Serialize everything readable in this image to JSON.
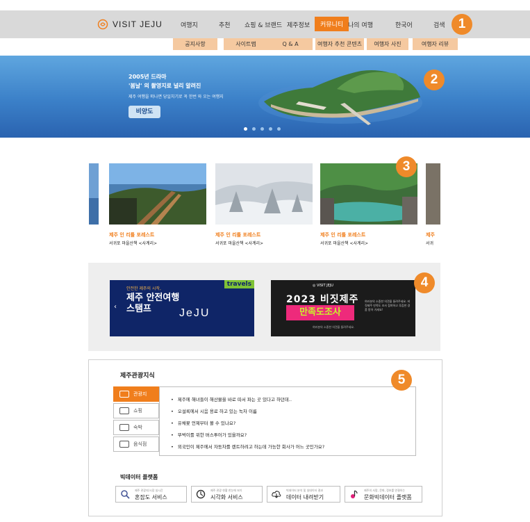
{
  "header": {
    "logo_text": "VISIT JEJU",
    "nav": [
      "여행지",
      "추천",
      "쇼핑 & 브랜드",
      "제주정보",
      "커뮤니티",
      "나의 여행",
      "한국어",
      "검색"
    ],
    "active_nav": "커뮤니티",
    "subnav": [
      "공지사항",
      "사이트맵",
      "Q & A",
      "여행자 추천 콘텐츠",
      "여행자 사진",
      "여행자 리뷰"
    ]
  },
  "badges": [
    "1",
    "2",
    "3",
    "4",
    "5"
  ],
  "hero": {
    "line1": "2005년 드라마",
    "line2": "'봄날' 의 촬영지로 널리 알려진",
    "line3": "제주 여행을 떠나면 당일치기로 꼭 한번 와 오는 여행지",
    "button": "비양도",
    "slide_count": 5,
    "active_slide": 1
  },
  "carousel": {
    "cards": [
      {
        "title": "제주 인 리틀 포레스트",
        "subtitle": "서귀포 마을산책 <사계리>"
      },
      {
        "title": "제주 인 리틀 포레스트",
        "subtitle": "서귀포 마을산책 <사계리>"
      },
      {
        "title": "제주 인 리틀 포레스트",
        "subtitle": "서귀포 마을산책 <사계리>"
      },
      {
        "title": "제주",
        "subtitle": "서귀"
      }
    ]
  },
  "banners": {
    "b1": {
      "small": "안전한 제주의 시작,",
      "big": "제주 안전여행 스탬프",
      "brand": "JeJU",
      "tag": "travels",
      "arrow": "‹"
    },
    "b2": {
      "logo": "◎ VISIT JEJU",
      "year": "2023 비짓제주",
      "title": "만족도조사",
      "info": "여러분의 소중한 의견을 들려주세요. 비짓제주 만족도 조사 참여하고 푸짐한 경품 받아 가세요!",
      "foot": "여러분의 소중한 의견을 들려주세요."
    }
  },
  "info": {
    "title": "제주관광지식",
    "tabs": [
      "관광지",
      "쇼핑",
      "숙박",
      "음식점"
    ],
    "faq": [
      "제주에 해녀들이 해산물을 바로 따서 파는 곳 있다고 하던데..",
      "오설록에서 시음 용료 하고 있는 녹차 이름",
      "유채꽃 언제부터 볼 수 있나요?",
      "뚜벅이를 위한 버스투어가 있을까요?",
      "외국인이 제주에서 자동차를 렌트하려고 하는데 가능한 회사가 어느 곳인가요?"
    ],
    "bigdata_title": "빅데이터 플랫폼",
    "bigdata_buttons": [
      {
        "small": "제주 관광지/시장 실시간",
        "label": "혼잡도 서비스"
      },
      {
        "small": "제주 관광 현황 한눈에 보기",
        "label": "시각화 서비스"
      },
      {
        "small": "빅데이터 분석 및 실데이터 결과",
        "label": "데이터 내려받기"
      },
      {
        "small": "제주의 사람, 문화, 정보를 연결하는",
        "label": "문화빅데이터 플랫폼"
      }
    ]
  },
  "colors": {
    "accent": "#f07e1c",
    "badge": "#ef8a2a",
    "hero": "#3b80c8"
  }
}
